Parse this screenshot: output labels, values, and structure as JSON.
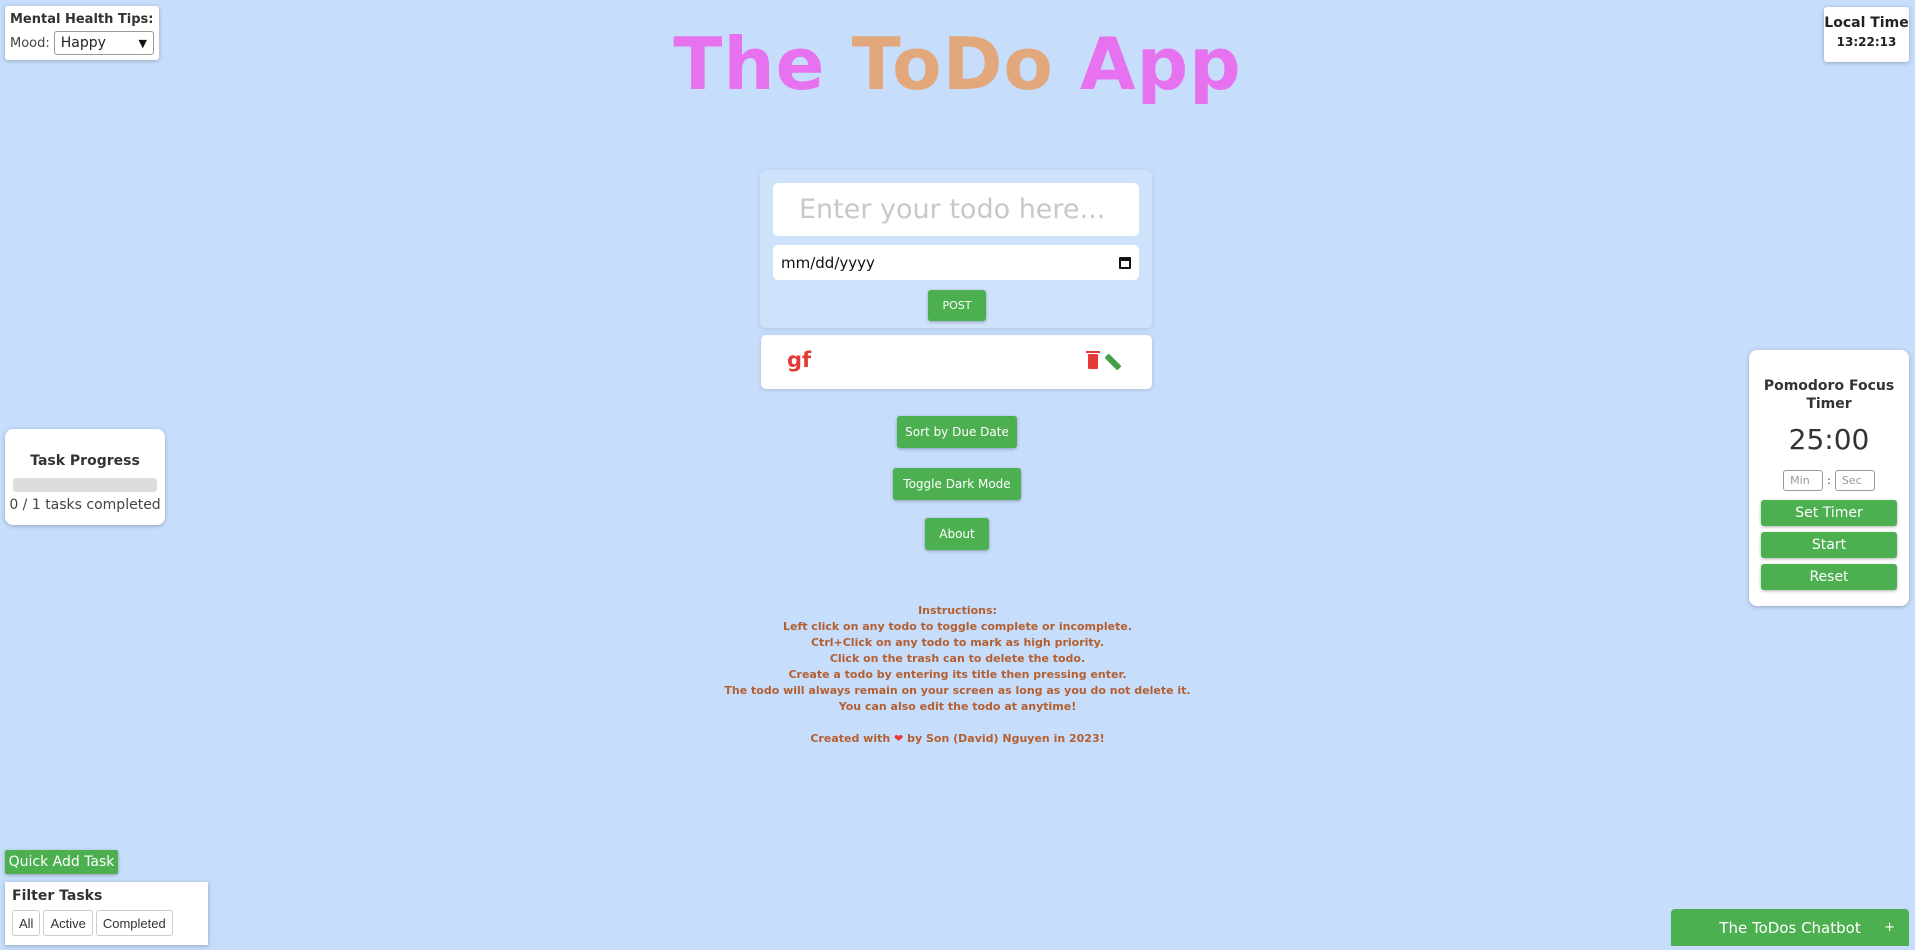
{
  "title": {
    "part1": "The",
    "part2": "ToDo",
    "part3": "App"
  },
  "mood": {
    "heading": "Mental Health Tips:",
    "label": "Mood:",
    "selected": "Happy"
  },
  "clock": {
    "label": "Local Time",
    "time": "13:22:13"
  },
  "form": {
    "placeholder": "Enter your todo here...",
    "date_placeholder": "mm/dd/yyyy",
    "post_label": "POST"
  },
  "todos": [
    {
      "text": "gf",
      "completed": false
    }
  ],
  "buttons": {
    "sort": "Sort by Due Date",
    "dark": "Toggle Dark Mode",
    "about": "About"
  },
  "instructions": {
    "lines": [
      "Instructions:",
      "Left click on any todo to toggle complete or incomplete.",
      "Ctrl+Click on any todo to mark as high priority.",
      "Click on the trash can to delete the todo.",
      "Create a todo by entering its title then pressing enter.",
      "The todo will always remain on your screen as long as you do not delete it.",
      "You can also edit the todo at anytime!"
    ],
    "credit_pre": "Created with",
    "credit_post": "by Son (David) Nguyen in 2023!"
  },
  "progress": {
    "heading": "Task Progress",
    "summary": "0 / 1 tasks completed",
    "completed_fraction": 0
  },
  "pomodoro": {
    "heading": "Pomodoro Focus Timer",
    "display": "25:00",
    "min_placeholder": "Min",
    "sec_placeholder": "Sec",
    "set_label": "Set Timer",
    "start_label": "Start",
    "reset_label": "Reset"
  },
  "quick_add": "Quick Add Task",
  "filter": {
    "heading": "Filter Tasks",
    "options": [
      "All",
      "Active",
      "Completed"
    ]
  },
  "chatbot": {
    "label": "The ToDos Chatbot",
    "toggle": "+"
  },
  "colors": {
    "background": "#c7ddfc",
    "accent": "#4caf50",
    "title_pink": "#e772ef",
    "title_orange": "#e3a77c",
    "todo_text": "#e53935",
    "instructions": "#b35f2f"
  }
}
